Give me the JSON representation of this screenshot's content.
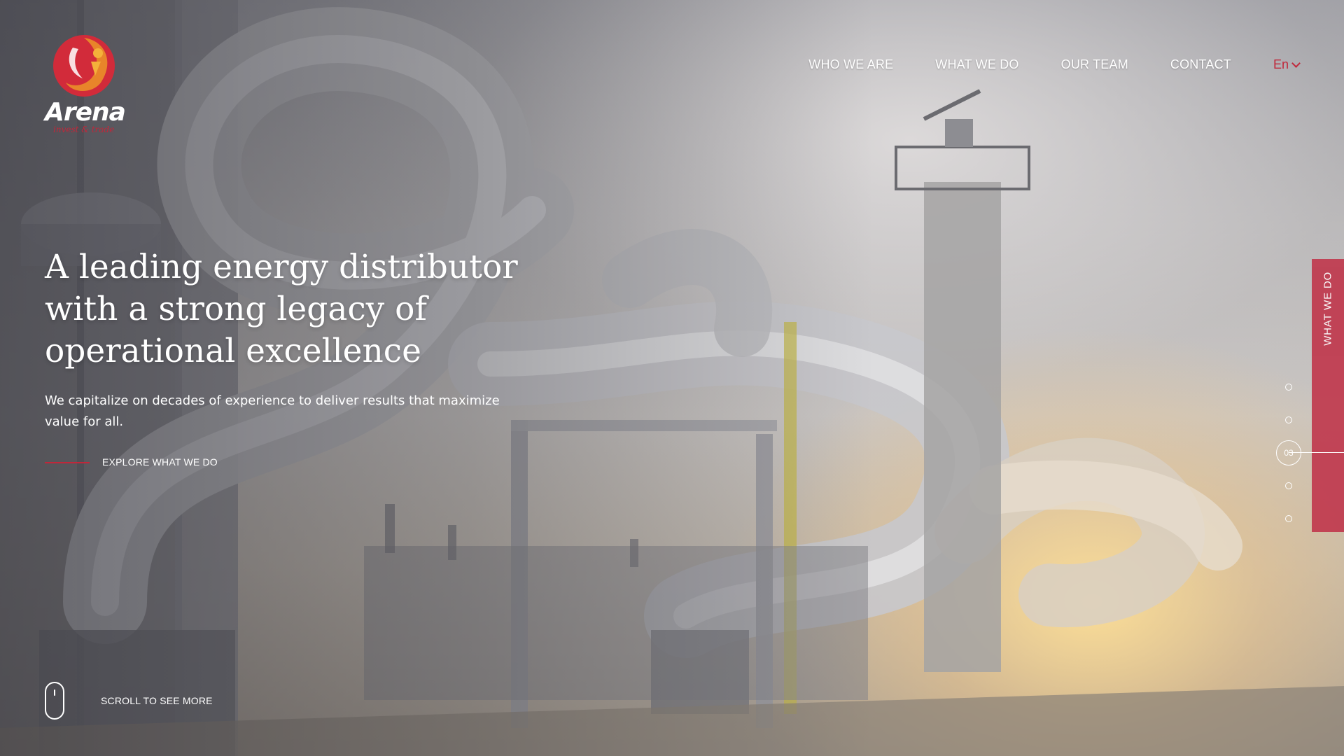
{
  "brand": {
    "name": "Arena",
    "tagline": "invest & trade",
    "accent_color": "#c0273a",
    "logo_orange": "#e8852a"
  },
  "nav": {
    "items": [
      {
        "label": "WHO WE ARE"
      },
      {
        "label": "WHAT WE DO"
      },
      {
        "label": "OUR TEAM"
      },
      {
        "label": "CONTACT"
      }
    ],
    "language": "En"
  },
  "hero": {
    "title": "A leading energy distributor with a strong legacy of operational excellence",
    "subtitle": "We capitalize on decades of experience to deliver results that maximize value for all.",
    "cta_label": "EXPLORE WHAT WE DO",
    "scroll_label": "SCROLL TO SEE MORE"
  },
  "side_tab": {
    "label": "WHAT WE DO"
  },
  "pager": {
    "total_slides": 5,
    "current_label": "03"
  },
  "icons": {
    "logo": "arena-swirl-logo",
    "language_chevron": "chevron-down-icon",
    "scroll": "mouse-icon"
  }
}
